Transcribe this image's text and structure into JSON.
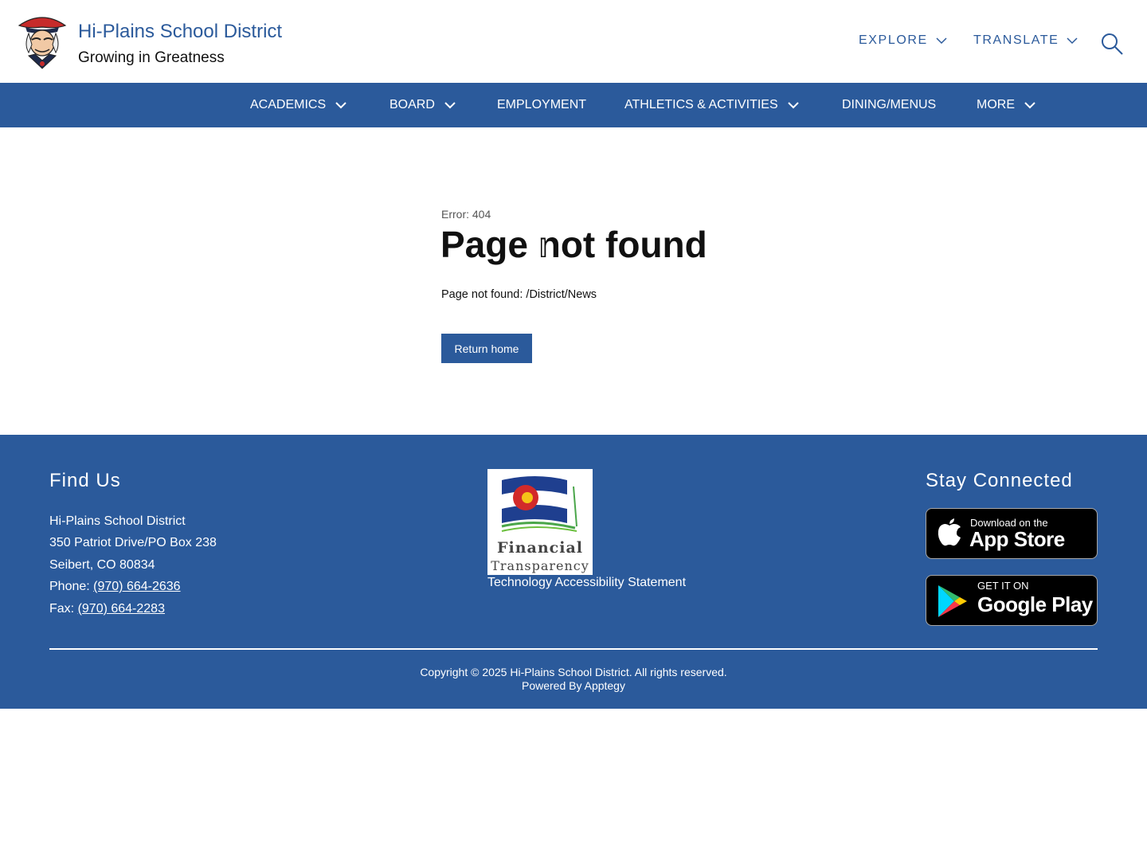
{
  "header": {
    "site_title": "Hi-Plains School District",
    "tagline": "Growing in Greatness",
    "explore_label": "EXPLORE",
    "translate_label": "TRANSLATE"
  },
  "nav": {
    "items": [
      {
        "label": "ACADEMICS",
        "has_dropdown": true
      },
      {
        "label": "BOARD",
        "has_dropdown": true
      },
      {
        "label": "EMPLOYMENT",
        "has_dropdown": false
      },
      {
        "label": "ATHLETICS & ACTIVITIES",
        "has_dropdown": true
      },
      {
        "label": "DINING/MENUS",
        "has_dropdown": false
      },
      {
        "label": "MORE",
        "has_dropdown": true
      }
    ]
  },
  "main": {
    "error_code": "Error: 404",
    "title": "Page not found",
    "detail": "Page not found: /District/News",
    "return_label": "Return home"
  },
  "footer": {
    "find_heading": "Find Us",
    "address": {
      "name": "Hi-Plains School District",
      "street": "350 Patriot Drive/PO Box 238",
      "city": "Seibert, CO 80834",
      "phone_label": "Phone: ",
      "phone": "(970) 664-2636",
      "fax_label": "Fax: ",
      "fax": "(970) 664-2283"
    },
    "ft_logo_line1": "Financial",
    "ft_logo_line2": "Transparency",
    "accessibility_link": "Technology Accessibility Statement",
    "stay_heading": "Stay Connected",
    "app_store_small": "Download on the",
    "app_store_big": "App Store",
    "google_small": "GET IT ON",
    "google_big": "Google Play",
    "copyright": "Copyright © 2025 Hi-Plains School District. All rights reserved.",
    "powered": "Powered By Apptegy"
  },
  "colors": {
    "brand_blue": "#2b5a9b",
    "text_dark": "#111111",
    "logo_red": "#c62b2b"
  },
  "icons": {
    "search": "search-icon",
    "chevron": "chevron-down-icon",
    "logo": "patriot-mascot-logo",
    "apple": "apple-icon",
    "google_play": "google-play-icon"
  }
}
